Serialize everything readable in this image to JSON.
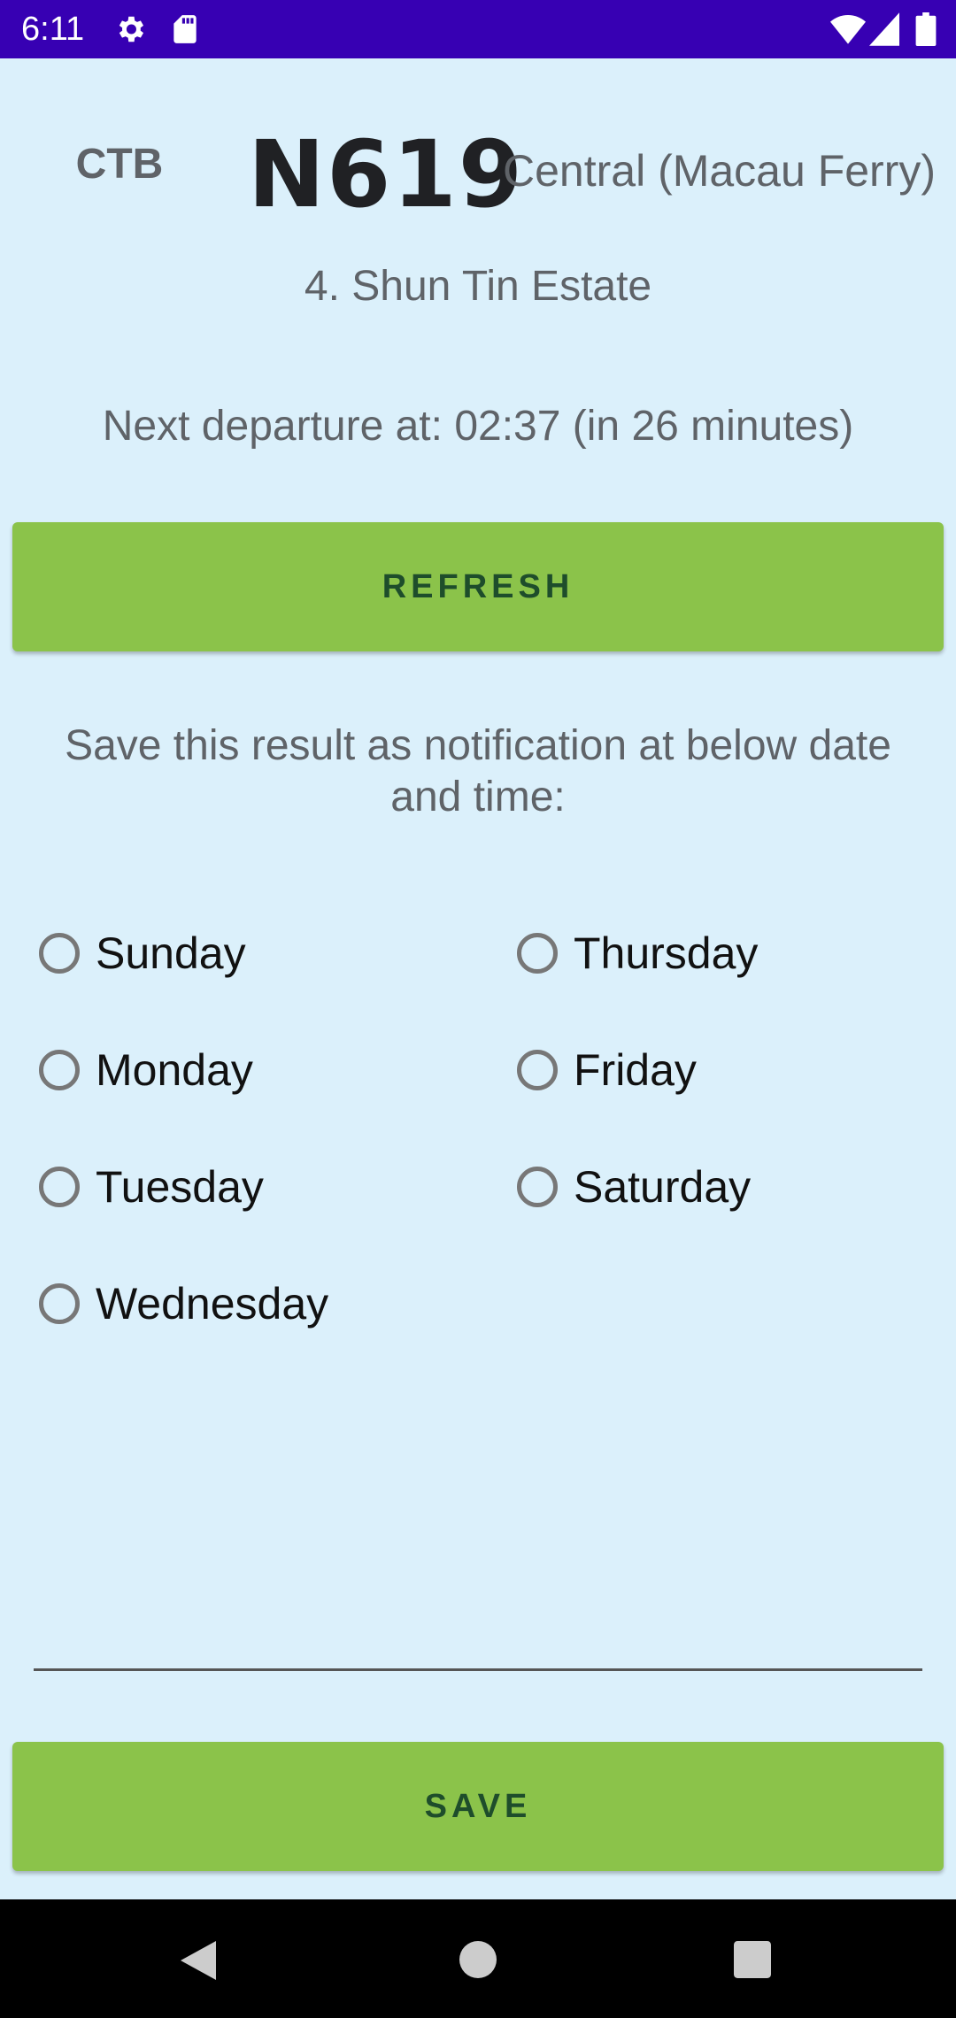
{
  "status_bar": {
    "time": "6:11",
    "left_icons": [
      "gear-icon",
      "sd-card-icon"
    ],
    "right_icons": [
      "wifi-icon",
      "cellular-signal-icon",
      "battery-icon"
    ],
    "background_color": "#3700b3"
  },
  "route": {
    "company": "CTB",
    "number": "N619",
    "destination": "Central (Macau Ferry)"
  },
  "stop": {
    "name": "4. Shun Tin Estate"
  },
  "departure": {
    "text": "Next departure at: 02:37 (in 26 minutes)"
  },
  "refresh_button": {
    "label": "REFRESH"
  },
  "save_prompt": {
    "text": "Save this result as notification at below date and time:"
  },
  "days": [
    {
      "label": "Sunday",
      "selected": false
    },
    {
      "label": "Monday",
      "selected": false
    },
    {
      "label": "Tuesday",
      "selected": false
    },
    {
      "label": "Wednesday",
      "selected": false
    },
    {
      "label": "Thursday",
      "selected": false
    },
    {
      "label": "Friday",
      "selected": false
    },
    {
      "label": "Saturday",
      "selected": false
    }
  ],
  "save_button": {
    "label": "SAVE"
  },
  "nav_bar": {
    "icons": [
      "back-icon",
      "home-icon",
      "recents-icon"
    ]
  },
  "colors": {
    "background": "#dbf0fb",
    "button_green": "#8bc34a",
    "button_text": "#1e4d2b"
  }
}
